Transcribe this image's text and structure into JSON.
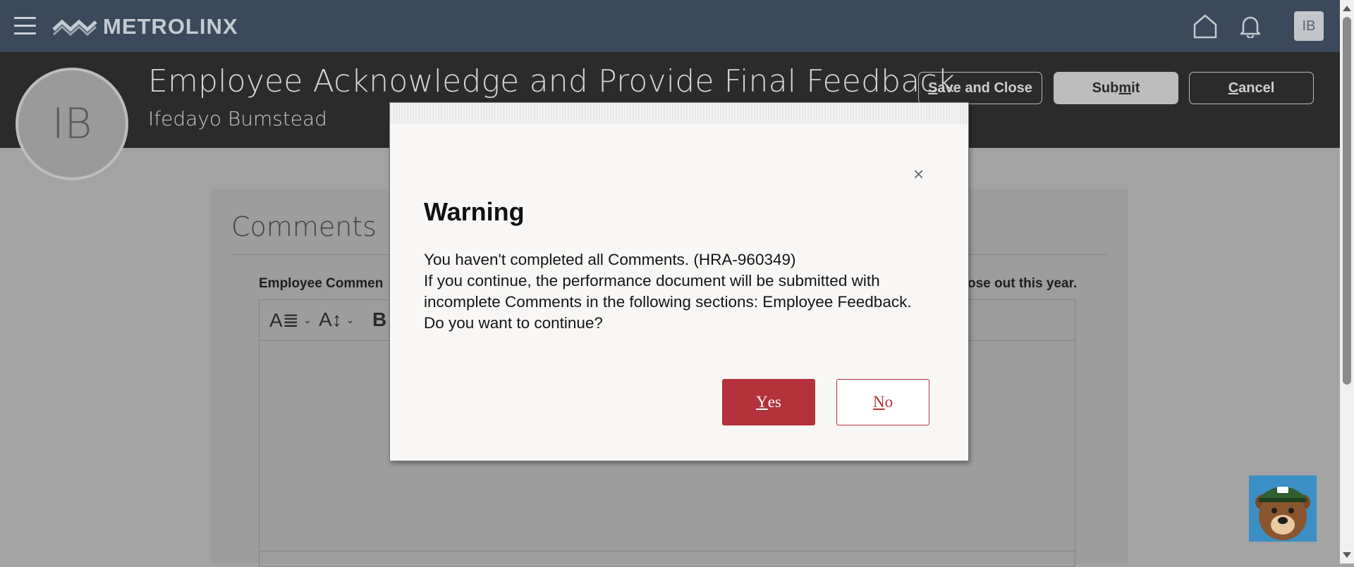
{
  "topbar": {
    "logo_text": "METROLINX",
    "user_initials": "IB",
    "icons": [
      "menu-icon",
      "metrolinx-logo-icon",
      "home-icon",
      "bell-icon"
    ]
  },
  "header": {
    "avatar_initials": "IB",
    "title": "Employee Acknowledge and Provide Final Feedback",
    "employee_name": "Ifedayo Bumstead",
    "buttons": {
      "save_close": {
        "pre": "",
        "key": "S",
        "post": "ave and Close"
      },
      "submit": {
        "pre": "Sub",
        "key": "m",
        "post": "it"
      },
      "cancel": {
        "pre": "",
        "key": "C",
        "post": "ancel"
      }
    }
  },
  "main": {
    "section_title": "Comments",
    "employee_comment_label": "Employee Commen",
    "employee_comment_label_tail": "ose out this year.",
    "toolbar": {
      "format_icon": "A≣",
      "size_icon": "A↕",
      "bold_icon": "B"
    }
  },
  "dialog": {
    "title": "Warning",
    "line1": "You haven't completed all Comments. (HRA-960349)",
    "line2": "If you continue, the performance document will be submitted with incomplete Comments in the following sections: Employee Feedback. Do you want to continue?",
    "yes": {
      "key": "Y",
      "rest": "es"
    },
    "no": {
      "key": "N",
      "rest": "o"
    },
    "close_glyph": "×"
  },
  "colors": {
    "topbar": "#3a4a5c",
    "header": "#2b2b2b",
    "overlay": "#a3a3a3",
    "accent": "#b2313a"
  }
}
